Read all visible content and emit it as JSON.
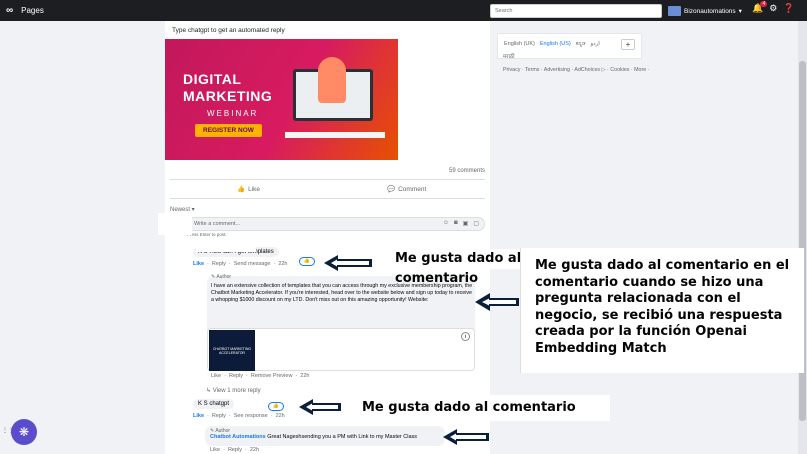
{
  "topbar": {
    "logo": "∞",
    "section": "Pages",
    "search_placeholder": "Search",
    "account_name": "Bizonautomations",
    "notif_count": "4"
  },
  "post": {
    "text": "Type chatgpt to get an automated reply",
    "banner": {
      "title_line1": "DIGITAL",
      "title_line2": "MARKETING",
      "subtitle": "WEBINAR",
      "button": "REGISTER NOW"
    },
    "comments_count": "59 comments",
    "like_label": "Like",
    "comment_label": "Comment",
    "sort_label": "Newest ▾",
    "write_placeholder": "Write a comment...",
    "write_hint": "Press Enter to post."
  },
  "comments": {
    "c1": {
      "text": "K S How can I get templates",
      "actions": [
        "Like",
        "Reply",
        "Send message",
        "22h"
      ]
    },
    "reply1": {
      "author_tag": "Author",
      "text": "I have an extensive collection of templates that you can access through my exclusive membership program, the Chatbot Marketing Accelerator. If you're interested, head over to the website below and sign up today to receive a whopping $1000 discount on my LTD. Don't miss out on this amazing opportunity! Website:",
      "link_image_text": "CHATBOT MARKETING ACCELERATOR",
      "actions": [
        "Like",
        "Reply",
        "Remove Preview",
        "22h"
      ]
    },
    "view_more": "View 1 more reply",
    "c2": {
      "text": "K S chatgpt",
      "actions": [
        "Like",
        "Reply",
        "See response",
        "22h"
      ]
    },
    "reply2": {
      "author_tag": "Author",
      "name": "Chatbot Automations",
      "text": "Great Nageshsending you a PM with Link to my Master Class",
      "actions": [
        "Like",
        "Reply",
        "22h"
      ]
    }
  },
  "overlays": {
    "label_top": "Me gusta dado al comentario",
    "label_bottom": "Me gusta dado al comentario",
    "explanation": "Me gusta dado al comentario en el comentario cuando se hizo una pregunta relacionada con el negocio, se recibió una respuesta creada por la función Openai Embedding Match"
  },
  "right": {
    "languages": [
      "English (UK)",
      "English (US)",
      "ಕನ್ನಡ",
      "اردو",
      "मराठी"
    ],
    "add_label": "+",
    "footer": "Privacy · Terms · Advertising · AdChoices ▷ · Cookies · More ·"
  },
  "colors": {
    "topbar": "#1c1e21",
    "accent": "#1877f2",
    "arrow": "#0b1f3a",
    "fab": "#5b4ccc"
  }
}
